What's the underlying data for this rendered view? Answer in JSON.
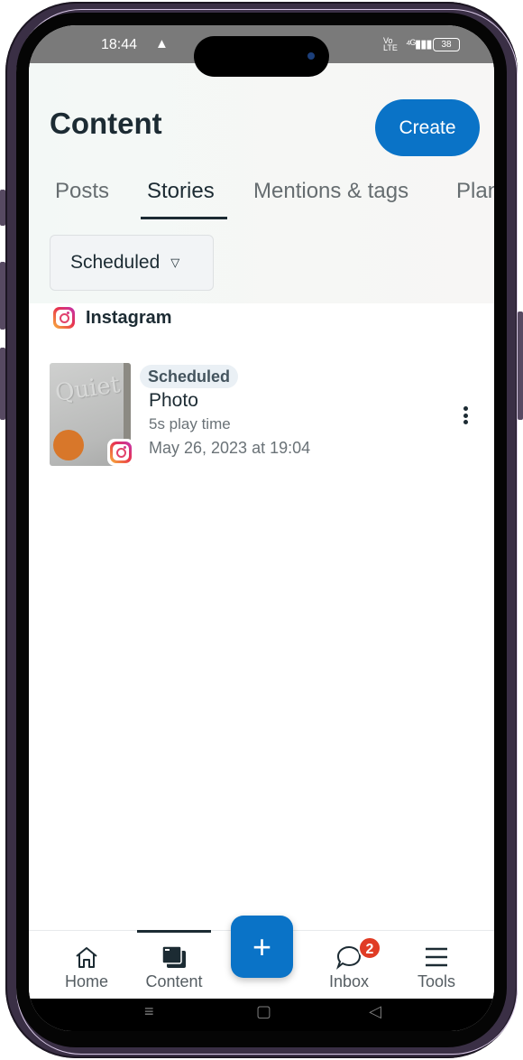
{
  "status_bar": {
    "time": "18:44",
    "alert_icon": "warning-triangle-icon",
    "volte": "Vo LTE",
    "network": "4G",
    "battery": "38"
  },
  "header": {
    "title": "Content",
    "create_label": "Create"
  },
  "tabs": [
    {
      "label": "Posts",
      "active": false
    },
    {
      "label": "Stories",
      "active": true
    },
    {
      "label": "Mentions & tags",
      "active": false
    },
    {
      "label": "Planner",
      "active": false
    }
  ],
  "filter": {
    "selected": "Scheduled"
  },
  "section": {
    "platform": "Instagram"
  },
  "stories": [
    {
      "status": "Scheduled",
      "type": "Photo",
      "play_time": "5s play time",
      "scheduled_at": "May 26, 2023 at 19:04",
      "thumbnail_text": "Quiet"
    }
  ],
  "bottom_nav": {
    "items": [
      {
        "label": "Home",
        "icon": "home-icon"
      },
      {
        "label": "Content",
        "icon": "content-icon",
        "active": true
      },
      {
        "label": "Inbox",
        "icon": "chat-icon",
        "badge": "2"
      },
      {
        "label": "Tools",
        "icon": "menu-icon"
      }
    ],
    "fab_label": "+"
  },
  "system_nav": {
    "recents": "≡",
    "home": "▢",
    "back": "◁"
  },
  "colors": {
    "accent": "#0a73c7",
    "text": "#1c2b33",
    "badge": "#e03c25"
  }
}
